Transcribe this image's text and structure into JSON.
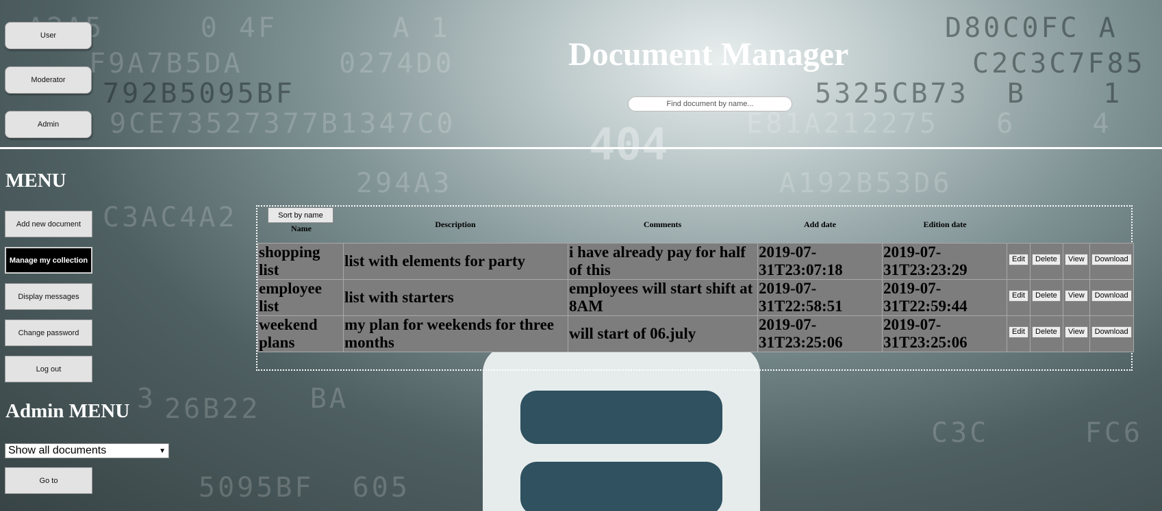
{
  "header": {
    "title": "Document Manager",
    "search_placeholder": "Find document by name...",
    "role_buttons": [
      "User",
      "Moderator",
      "Admin"
    ]
  },
  "menu": {
    "heading": "MENU",
    "items": [
      "Add new document",
      "Manage my collection",
      "Display messages",
      "Change password",
      "Log out"
    ],
    "active_item": "Manage my collection"
  },
  "admin_menu": {
    "heading": "Admin MENU",
    "selected_option": "Show all documents",
    "go_button": "Go to"
  },
  "documents": {
    "sort_button": "Sort by name",
    "columns": [
      "Name",
      "Description",
      "Comments",
      "Add date",
      "Edition date"
    ],
    "rows": [
      {
        "name": "shopping list",
        "description": "list with elements for party",
        "comments": "i have already pay for half of this",
        "add_date": "2019-07-31T23:07:18",
        "edition_date": "2019-07-31T23:23:29"
      },
      {
        "name": "employee list",
        "description": "list with starters",
        "comments": "employees will start shift at 8AM",
        "add_date": "2019-07-31T22:58:51",
        "edition_date": "2019-07-31T22:59:44"
      },
      {
        "name": "weekend plans",
        "description": "my plan for weekends for three months",
        "comments": "will start of 06.july",
        "add_date": "2019-07-31T23:25:06",
        "edition_date": "2019-07-31T23:25:06"
      }
    ],
    "actions": [
      "Edit",
      "Delete",
      "View",
      "Download"
    ]
  }
}
